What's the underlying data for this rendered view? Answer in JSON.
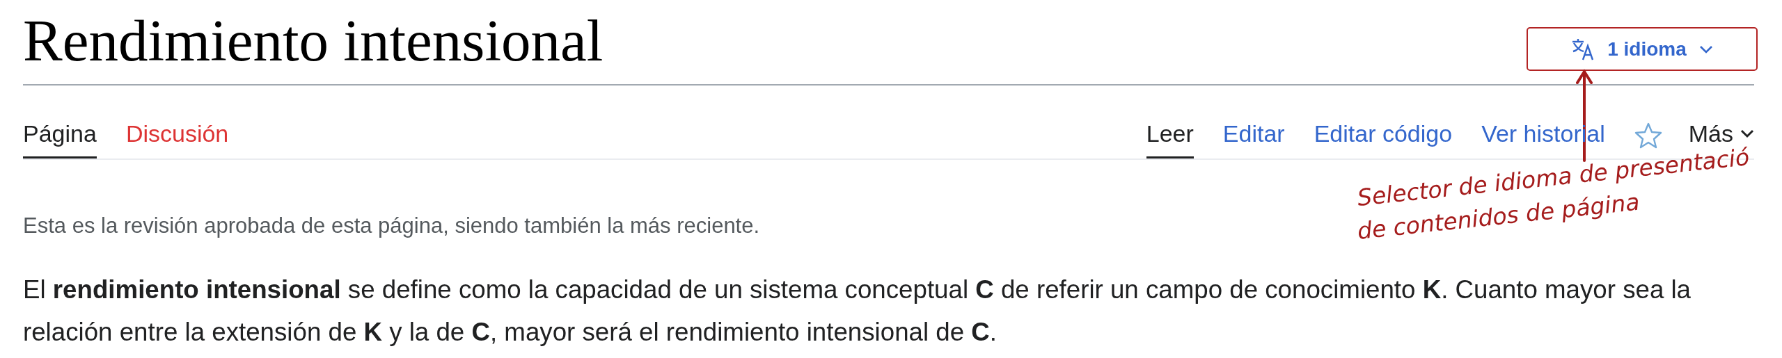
{
  "title": "Rendimiento intensional",
  "language_button": {
    "label": "1 idioma"
  },
  "namespace_tabs": [
    {
      "label": "Página",
      "selected": true,
      "exists": true
    },
    {
      "label": "Discusión",
      "selected": false,
      "exists": false
    }
  ],
  "view_tabs": [
    {
      "label": "Leer",
      "selected": true
    },
    {
      "label": "Editar",
      "selected": false
    },
    {
      "label": "Editar código",
      "selected": false
    },
    {
      "label": "Ver historial",
      "selected": false
    }
  ],
  "watch_star": {
    "watched": false
  },
  "more_menu": {
    "label": "Más"
  },
  "notice": "Esta es la revisión aprobada de esta página, siendo también la más reciente.",
  "paragraph": "El **rendimiento intensional** se define como la capacidad de un sistema conceptual **C** de referir un campo de conocimiento **K**. Cuanto mayor sea la relación entre la extensión de **K** y la de **C**, mayor será el rendimiento intensional de **C**.",
  "annotation": {
    "lines": [
      "Selector de idioma de presentació",
      "de contenidos de página"
    ]
  }
}
